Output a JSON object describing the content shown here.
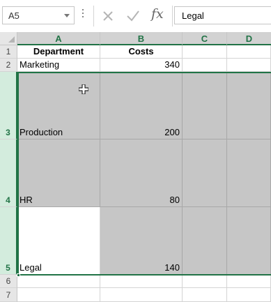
{
  "formula_bar": {
    "name_box": "A5",
    "cancel_symbol": "✕",
    "enter_symbol": "✓",
    "fx_label": "fx",
    "content": "Legal"
  },
  "columns": [
    "A",
    "B",
    "C",
    "D"
  ],
  "rows": [
    "1",
    "2",
    "3",
    "4",
    "5",
    "6",
    "7"
  ],
  "cells": {
    "A1": "Department",
    "B1": "Costs",
    "A2": "Marketing",
    "B2": "340",
    "A3": "Production",
    "B3": "200",
    "A4": "HR",
    "B4": "80",
    "A5": "Legal",
    "B5": "140"
  },
  "selection": {
    "active_cell": "A5",
    "range": "A3:D5"
  },
  "colors": {
    "accent": "#217346",
    "highlight": "#c6c6c6",
    "header": "#e6e6e6"
  },
  "icons": {
    "cursor": "cell-select-cross-icon"
  }
}
